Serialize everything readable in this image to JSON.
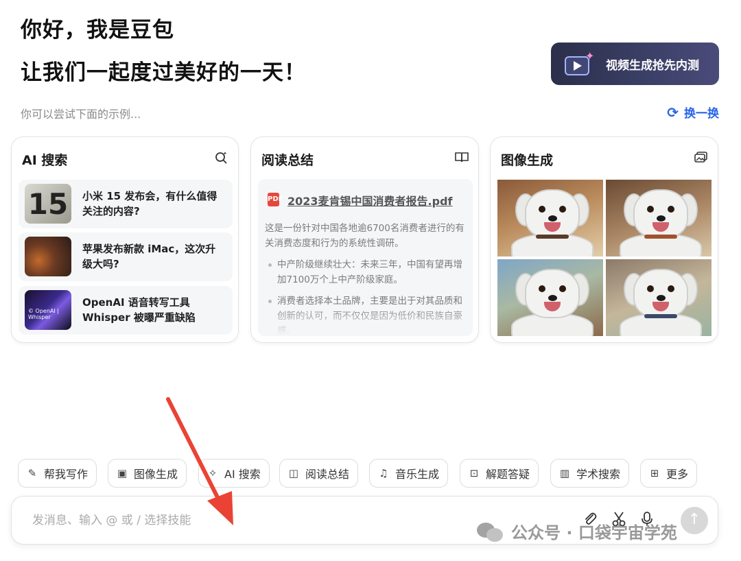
{
  "header": {
    "greeting_line1": "你好，我是豆包",
    "greeting_line2": "让我们一起度过美好的一天！",
    "promo_label": "视频生成抢先内测",
    "hint": "你可以尝试下面的示例...",
    "refresh_label": "换一换"
  },
  "cards": {
    "search": {
      "title": "AI 搜索",
      "icon": "ai-search-icon",
      "items": [
        {
          "text": "小米 15 发布会，有什么值得关注的内容?",
          "thumb_text": "15"
        },
        {
          "text": "苹果发布新款 iMac，这次升级大吗?"
        },
        {
          "text": "OpenAI 语音转写工具 Whisper 被曝严重缺陷",
          "thumb_text": "© OpenAI | Whisper"
        }
      ]
    },
    "read": {
      "title": "阅读总结",
      "icon": "book-icon",
      "pdf_badge": "PDF",
      "file_name": "2023麦肯锡中国消费者报告.pdf",
      "intro": "这是一份针对中国各地逾6700名消费者进行的有关消费态度和行为的系统性调研。",
      "bullets": [
        "中产阶级继续壮大：未来三年，中国有望再增加7100万个上中产阶级家庭。",
        "消费者选择本土品牌，主要是出于对其品质和创新的认可，而不仅仅是因为低价和民族自豪感。"
      ]
    },
    "image": {
      "title": "图像生成",
      "icon": "image-gallery-icon"
    }
  },
  "skills": [
    {
      "label": "帮我写作",
      "icon": "pen-sparkle-icon",
      "glyph": "✎"
    },
    {
      "label": "图像生成",
      "icon": "image-icon",
      "glyph": "▣"
    },
    {
      "label": "AI 搜索",
      "icon": "ai-search-icon",
      "glyph": "✧"
    },
    {
      "label": "阅读总结",
      "icon": "read-icon",
      "glyph": "◫"
    },
    {
      "label": "音乐生成",
      "icon": "music-icon",
      "glyph": "♫"
    },
    {
      "label": "解题答疑",
      "icon": "question-icon",
      "glyph": "⊡"
    },
    {
      "label": "学术搜索",
      "icon": "library-icon",
      "glyph": "▥"
    },
    {
      "label": "更多",
      "icon": "grid-more-icon",
      "glyph": "⊞"
    }
  ],
  "composer": {
    "placeholder": "发消息、输入 @ 或 / 选择技能"
  },
  "watermark": {
    "text": "公众号 · 口袋宇宙学苑"
  },
  "colors": {
    "accent": "#2764e8",
    "annotation_arrow": "#ea4335",
    "promo_bg": "#2b2f4a"
  }
}
